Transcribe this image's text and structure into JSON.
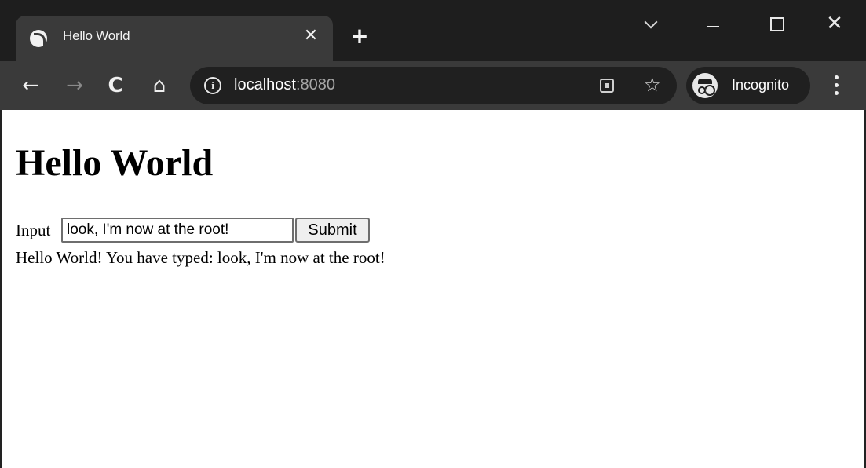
{
  "browser": {
    "tab": {
      "title": "Hello World",
      "favicon": "globe-icon",
      "close_label": "✕"
    },
    "new_tab_label": "+",
    "window_controls": {
      "tab_search": "chevron-down-icon",
      "minimize": "minimize-icon",
      "maximize": "maximize-icon",
      "close_label": "✕"
    },
    "toolbar": {
      "back_label": "←",
      "forward_label": "→",
      "reload_label": "C",
      "home_label": "⌂",
      "url_host": "localhost",
      "url_port": ":8080",
      "info_label": "i",
      "star_label": "☆",
      "profile_label": "Incognito"
    },
    "colors": {
      "titlebar": "#1e1e1e",
      "tab": "#3a3a3a",
      "omnibox": "#202020"
    }
  },
  "page": {
    "heading": "Hello World",
    "form": {
      "label": "Input",
      "input_value": "look, I'm now at the root!",
      "submit_label": "Submit"
    },
    "result": "Hello World! You have typed: look, I'm now at the root!"
  }
}
